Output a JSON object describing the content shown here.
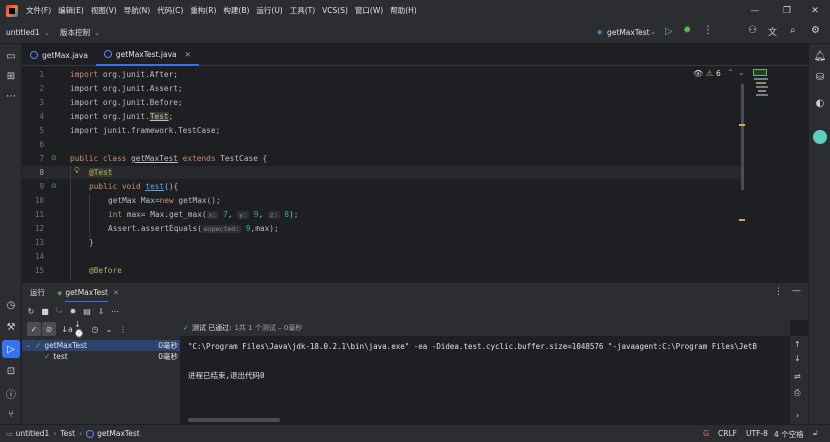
{
  "menubar": {
    "items": [
      "文件(F)",
      "编辑(E)",
      "视图(V)",
      "导航(N)",
      "代码(C)",
      "重构(R)",
      "构建(B)",
      "运行(U)",
      "工具(T)",
      "VCS(S)",
      "窗口(W)",
      "帮助(H)"
    ]
  },
  "toolbar": {
    "project": "untitled1",
    "vcs": "版本控制",
    "run_config": "getMaxTest"
  },
  "tabs": [
    {
      "label": "getMax.java"
    },
    {
      "label": "getMaxTest.java",
      "active": true
    }
  ],
  "editor": {
    "warnings": "6",
    "lines": [
      {
        "n": "1"
      },
      {
        "n": "2"
      },
      {
        "n": "3"
      },
      {
        "n": "4"
      },
      {
        "n": "5"
      },
      {
        "n": "6"
      },
      {
        "n": "7"
      },
      {
        "n": "8"
      },
      {
        "n": "9"
      },
      {
        "n": "10"
      },
      {
        "n": "11"
      },
      {
        "n": "12"
      },
      {
        "n": "13"
      },
      {
        "n": "14"
      },
      {
        "n": "15"
      }
    ],
    "code": {
      "l1": "import org.junit.After;",
      "l2": "import org.junit.Assert;",
      "l3": "import org.junit.Before;",
      "l4_pre": "import org.junit.",
      "l4_ul": "Test",
      "l4_post": ";",
      "l5": "import junit.framework.TestCase;",
      "l7_kw": "public class ",
      "l7_name": "getMaxTest",
      "l7_kw2": " extends ",
      "l7_post": "TestCase {",
      "l8": "@Test",
      "l9_kw": "public void ",
      "l9_fn": "test",
      "l9_post": "(){",
      "l10_a": "getMax Max=",
      "l10_kw": "new",
      "l10_b": " getMax();",
      "l11_kw": "int",
      "l11_a": " max= Max.get_max(",
      "l11_h1": "x:",
      "l11_n1": "7",
      "l11_h2": "y:",
      "l11_n2": "9",
      "l11_h3": "z:",
      "l11_n3": "8",
      "l11_end": ");",
      "l12_a": "Assert.assertEquals(",
      "l12_h": "expected:",
      "l12_n": "9",
      "l12_end": ",max);",
      "l13": "}",
      "l15": "@Before"
    }
  },
  "run_panel": {
    "tab_run": "运行",
    "tab_config": "getMaxTest",
    "status_prefix": "测试 已通过:",
    "status_detail": "1共 1 个测试 – 0毫秒",
    "tree": [
      {
        "label": "getMaxTest",
        "time": "0毫秒"
      },
      {
        "label": "test",
        "time": "0毫秒"
      }
    ],
    "console": [
      "\"C:\\Program Files\\Java\\jdk-18.0.2.1\\bin\\java.exe\" -ea -Didea.test.cyclic.buffer.size=1048576 \"-javaagent:C:\\Program Files\\JetB",
      "进程已结束,退出代码0"
    ]
  },
  "statusbar": {
    "crumbs": [
      "untitled1",
      "Test",
      "getMaxTest"
    ],
    "line_sep": "CRLF",
    "encoding": "UTF-8",
    "indent": "4 个空格"
  },
  "colors": {
    "accent": "#3574f0",
    "pass": "#5fb85f"
  }
}
